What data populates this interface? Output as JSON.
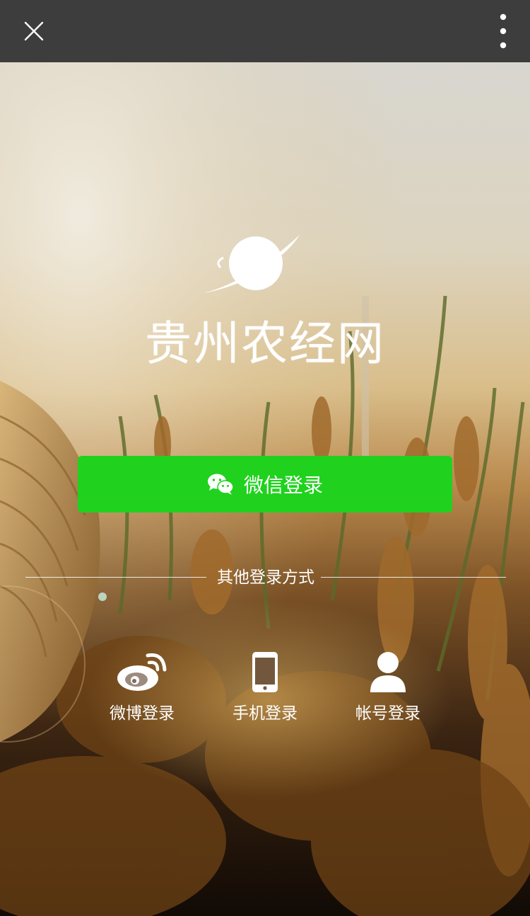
{
  "topbar": {
    "close_icon": "close-icon",
    "more_icon": "more-vertical-icon",
    "background_color": "#3d3d3d"
  },
  "brand": {
    "logo_icon": "planet-logo-icon",
    "name": "贵州农经网"
  },
  "primary_login": {
    "label": "微信登录",
    "icon": "wechat-icon",
    "color": "#20d21e"
  },
  "other_logins": {
    "divider_label": "其他登录方式",
    "items": [
      {
        "label": "微博登录",
        "icon": "weibo-icon"
      },
      {
        "label": "手机登录",
        "icon": "phone-icon"
      },
      {
        "label": "帐号登录",
        "icon": "user-icon"
      }
    ]
  }
}
